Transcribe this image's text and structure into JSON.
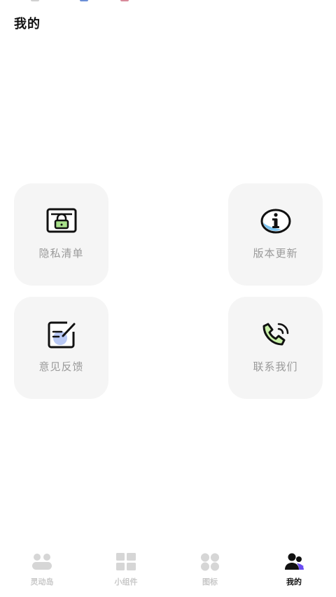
{
  "page": {
    "title": "我的"
  },
  "tiles": [
    {
      "id": "privacy",
      "label": "隐私清单",
      "icon": "privacy-list-icon"
    },
    {
      "id": "version",
      "label": "版本更新",
      "icon": "info-icon"
    },
    {
      "id": "feedback",
      "label": "意见反馈",
      "icon": "edit-icon"
    },
    {
      "id": "contact",
      "label": "联系我们",
      "icon": "phone-call-icon"
    }
  ],
  "tabbar": {
    "active": "我的",
    "items": [
      {
        "label": "灵动岛",
        "icon": "dynamic-island-icon"
      },
      {
        "label": "小组件",
        "icon": "widgets-grid-icon"
      },
      {
        "label": "图标",
        "icon": "icons-dots-icon"
      },
      {
        "label": "我的",
        "icon": "users-icon"
      }
    ]
  },
  "colors": {
    "tile_bg": "#f5f5f5",
    "label_gray": "#9a9a9a",
    "tab_inactive": "#c8c8c8",
    "accent_purple": "#6a4cf2",
    "accent_blue": "#7cc4f0",
    "accent_green": "#c8f0a8"
  }
}
